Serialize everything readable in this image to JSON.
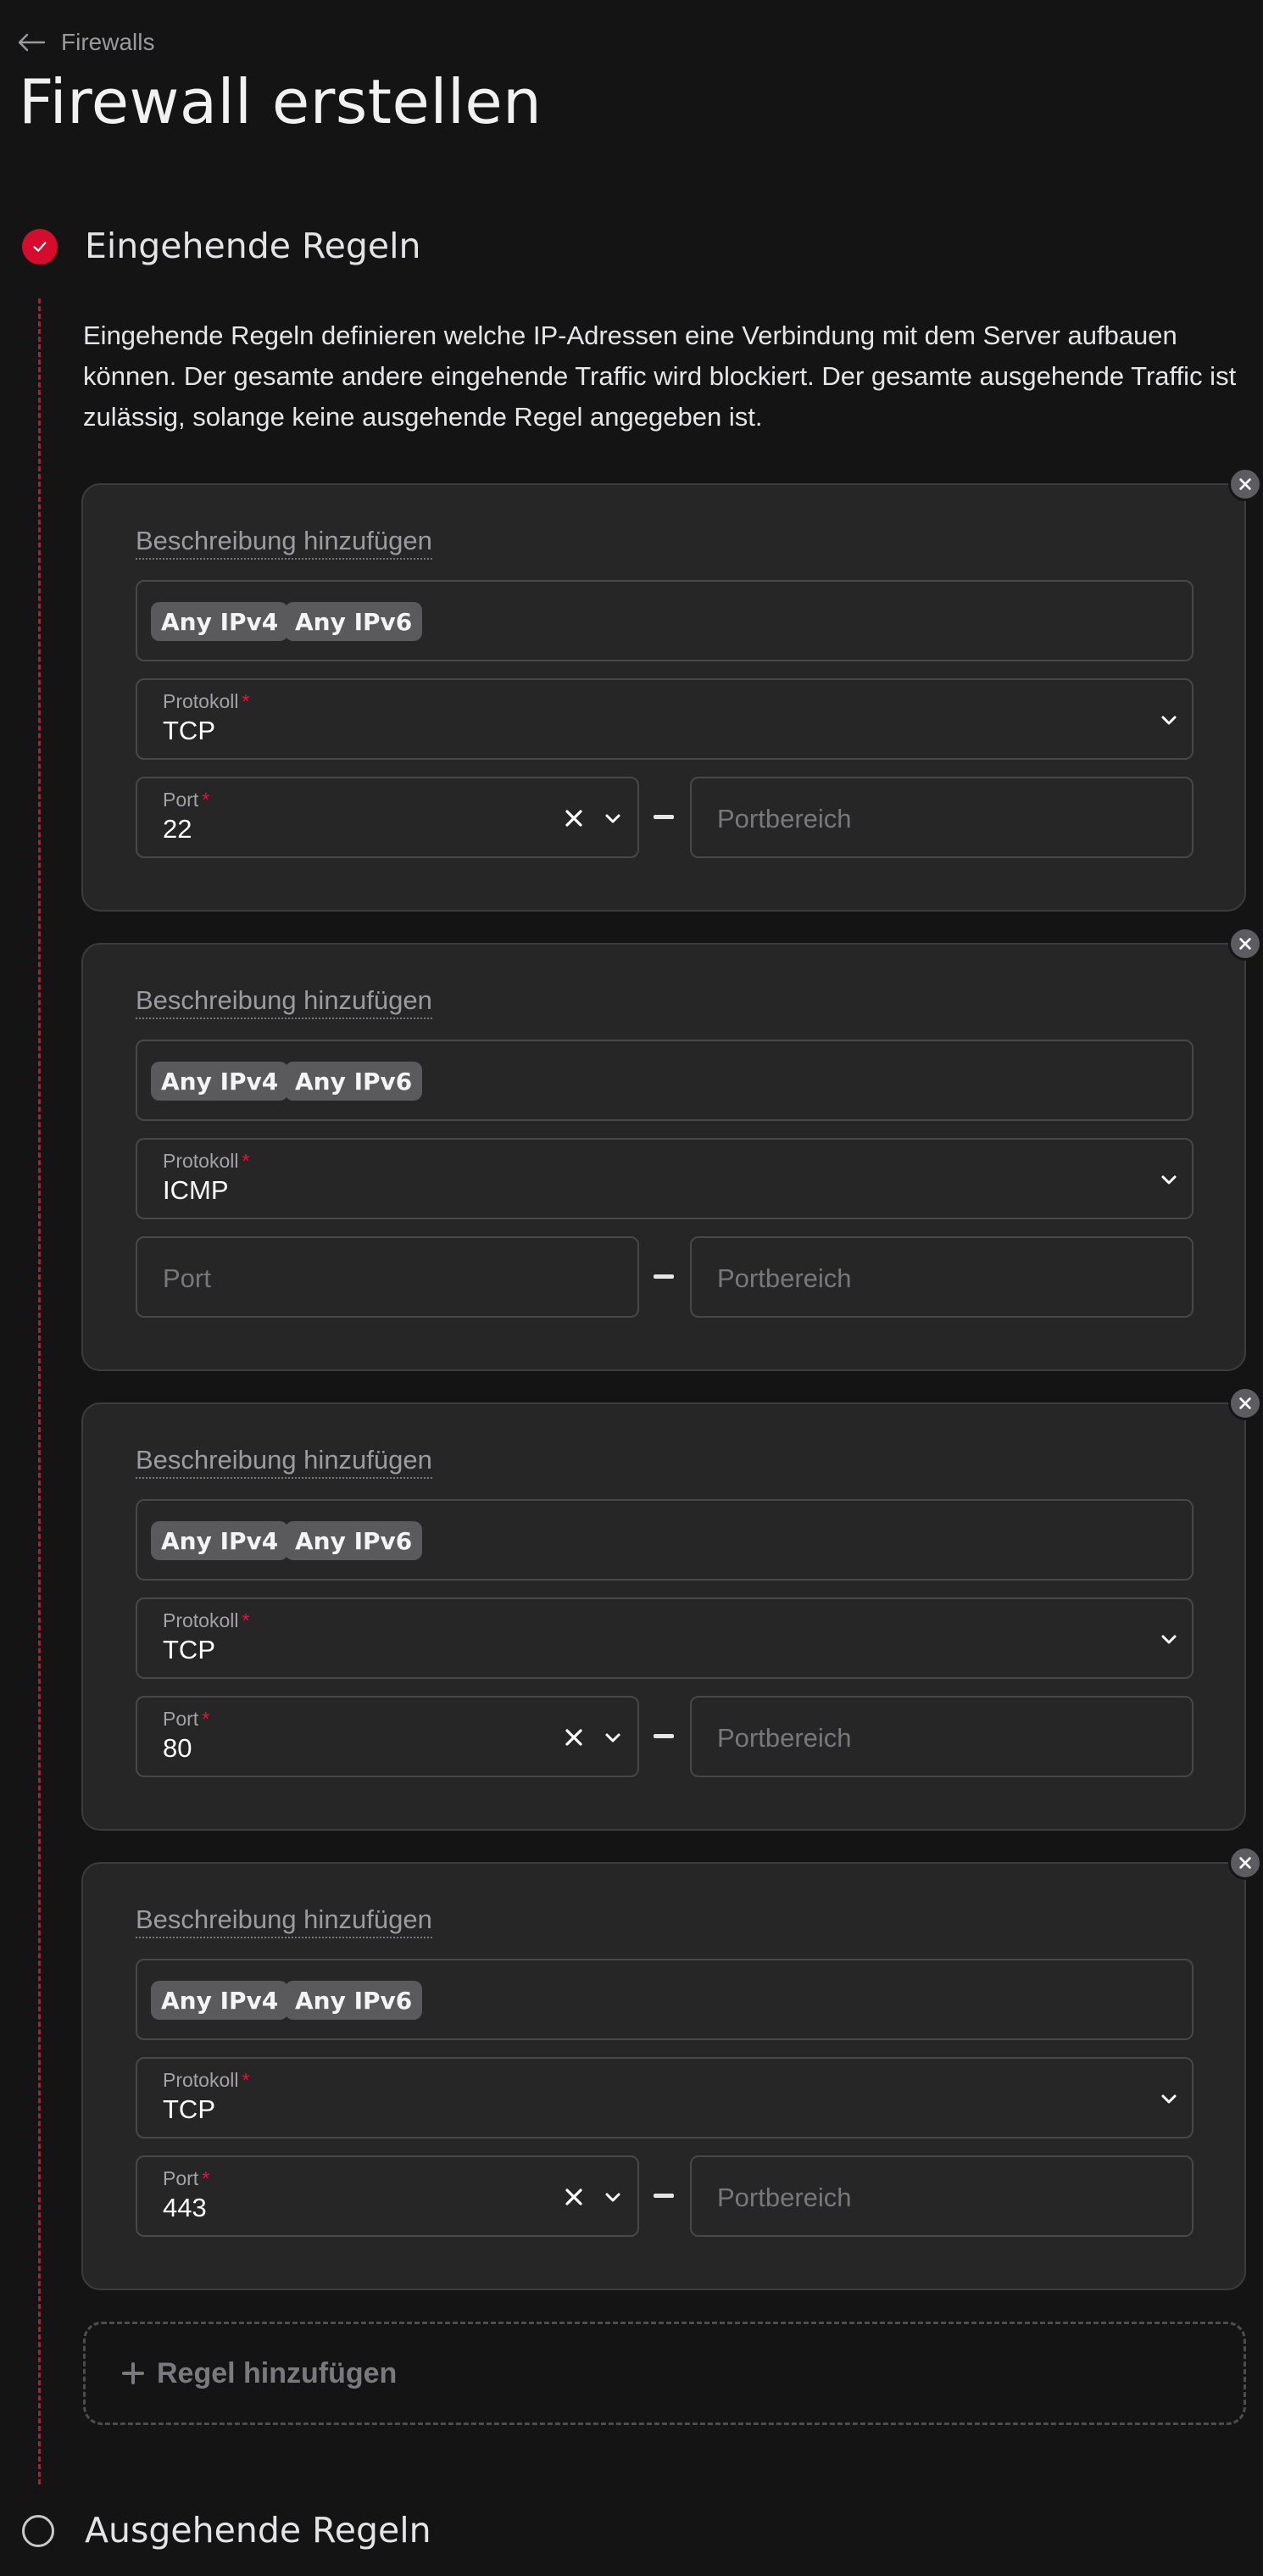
{
  "breadcrumb": {
    "back_label": "Firewalls"
  },
  "page": {
    "title": "Firewall erstellen"
  },
  "inbound": {
    "title": "Eingehende Regeln",
    "description": "Eingehende Regeln definieren welche IP-Adressen eine Verbindung mit dem Server aufbauen können. Der gesamte andere eingehende Traffic wird blockiert. Der gesamte ausgehende Traffic ist zulässig, solange keine ausgehende Regel angegeben ist.",
    "rules": [
      {
        "description_link": "Beschreibung hinzufügen",
        "sources": [
          "Any IPv4",
          "Any IPv6"
        ],
        "protocol_label": "Protokoll",
        "protocol": "TCP",
        "port_label": "Port",
        "port": "22",
        "port_placeholder": "Port",
        "range_placeholder": "Portbereich"
      },
      {
        "description_link": "Beschreibung hinzufügen",
        "sources": [
          "Any IPv4",
          "Any IPv6"
        ],
        "protocol_label": "Protokoll",
        "protocol": "ICMP",
        "port_label": "Port",
        "port": "",
        "port_placeholder": "Port",
        "range_placeholder": "Portbereich"
      },
      {
        "description_link": "Beschreibung hinzufügen",
        "sources": [
          "Any IPv4",
          "Any IPv6"
        ],
        "protocol_label": "Protokoll",
        "protocol": "TCP",
        "port_label": "Port",
        "port": "80",
        "port_placeholder": "Port",
        "range_placeholder": "Portbereich"
      },
      {
        "description_link": "Beschreibung hinzufügen",
        "sources": [
          "Any IPv4",
          "Any IPv6"
        ],
        "protocol_label": "Protokoll",
        "protocol": "TCP",
        "port_label": "Port",
        "port": "443",
        "port_placeholder": "Port",
        "range_placeholder": "Portbereich"
      }
    ],
    "add_rule_label": "Regel hinzufügen"
  },
  "outbound": {
    "title": "Ausgehende Regeln"
  },
  "colors": {
    "accent": "#d50c2d",
    "background": "#141415",
    "card": "#262627"
  }
}
